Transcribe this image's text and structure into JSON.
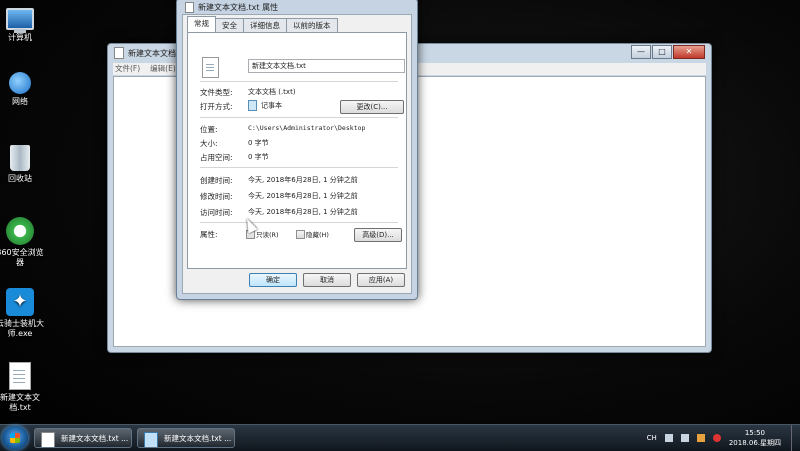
{
  "desktop": {
    "icons": [
      {
        "label": "计算机"
      },
      {
        "label": "网络"
      },
      {
        "label": "回收站"
      },
      {
        "label": "360安全浏览器"
      },
      {
        "label": "云骑士装机大师.exe"
      },
      {
        "label": "新建文本文档.txt"
      }
    ]
  },
  "notepad": {
    "title": "新建文本文档.txt - 记事本",
    "menu": [
      "文件(F)",
      "编辑(E)"
    ],
    "controls": {
      "minimize": "—",
      "maximize": "□",
      "close": "✕"
    }
  },
  "properties": {
    "title": "新建文本文档.txt 属性",
    "tabs": [
      "常规",
      "安全",
      "详细信息",
      "以前的版本"
    ],
    "active_tab": "常规",
    "filename": "新建文本文档.txt",
    "file_type_label": "文件类型:",
    "file_type_value": "文本文档 (.txt)",
    "opens_with_label": "打开方式:",
    "opens_with_value": "记事本",
    "change_button": "更改(C)...",
    "location_label": "位置:",
    "location_value": "C:\\Users\\Administrator\\Desktop",
    "size_label": "大小:",
    "size_value": "0 字节",
    "size_on_disk_label": "占用空间:",
    "size_on_disk_value": "0 字节",
    "created_label": "创建时间:",
    "created_value": "今天, 2018年6月28日, 1 分钟之前",
    "modified_label": "修改时间:",
    "modified_value": "今天, 2018年6月28日, 1 分钟之前",
    "accessed_label": "访问时间:",
    "accessed_value": "今天, 2018年6月28日, 1 分钟之前",
    "attributes_label": "属性:",
    "readonly_label": "只读(R)",
    "hidden_label": "隐藏(H)",
    "advanced_button": "高级(D)...",
    "ok_button": "确定",
    "cancel_button": "取消",
    "apply_button": "应用(A)"
  },
  "taskbar": {
    "buttons": [
      {
        "label": "新建文本文档.txt ..."
      },
      {
        "label": "新建文本文档.txt ..."
      }
    ],
    "lang": "CH",
    "time": "15:50",
    "date": "2018.06.星期四"
  }
}
